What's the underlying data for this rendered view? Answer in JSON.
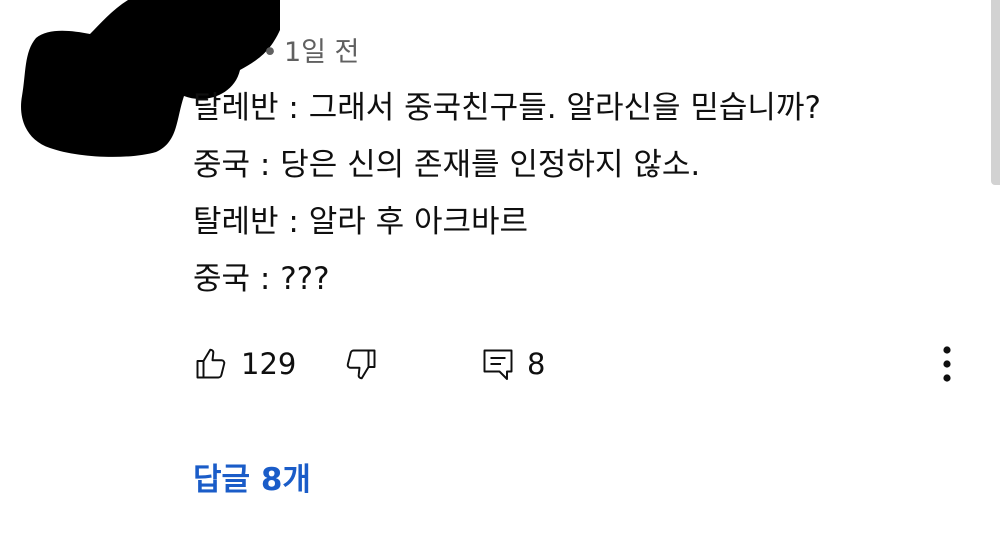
{
  "comment": {
    "timestamp": "1일 전",
    "separator": "•",
    "lines": [
      "탈레반 : 그래서 중국친구들. 알라신을 믿습니까?",
      "중국 : 당은 신의 존재를 인정하지 않소.",
      "탈레반 : 알라 후 아크바르",
      "중국 : ???"
    ]
  },
  "actions": {
    "like_icon": "thumbs-up-icon",
    "like_count": "129",
    "dislike_icon": "thumbs-down-icon",
    "reply_icon": "comment-icon",
    "reply_count": "8",
    "more_icon": "more-vertical-icon"
  },
  "replies": {
    "label": "답글 8개",
    "color": "#1a5cc8"
  },
  "colors": {
    "text": "#0f0f0f",
    "meta": "#606060",
    "redaction": "#000000"
  }
}
